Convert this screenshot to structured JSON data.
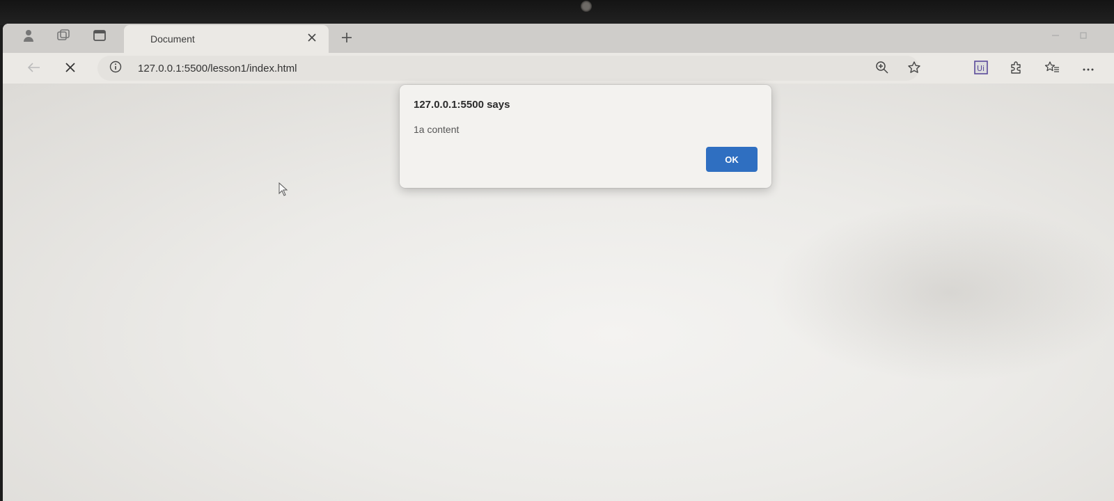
{
  "tab": {
    "title": "Document"
  },
  "address_bar": {
    "url": "127.0.0.1:5500/lesson1/index.html"
  },
  "icons": {
    "profile": "profile-icon",
    "workspaces": "workspaces-icon",
    "tab_actions": "tab-actions-icon",
    "tab_close": "close-icon",
    "new_tab": "plus-icon",
    "stop": "close-icon",
    "site_info": "info-icon",
    "zoom": "zoom-in-icon",
    "favorite": "star-icon",
    "extension_ui": "ui-extension-icon",
    "extensions": "puzzle-icon",
    "favorites": "favorites-list-icon",
    "menu": "more-icon"
  },
  "dialog": {
    "title": "127.0.0.1:5500 says",
    "message": "1a content",
    "ok_label": "OK"
  },
  "colors": {
    "ok_button": "#2f6fc1",
    "dialog_bg": "#f3f2ef",
    "page_bg": "#ecebe8"
  }
}
